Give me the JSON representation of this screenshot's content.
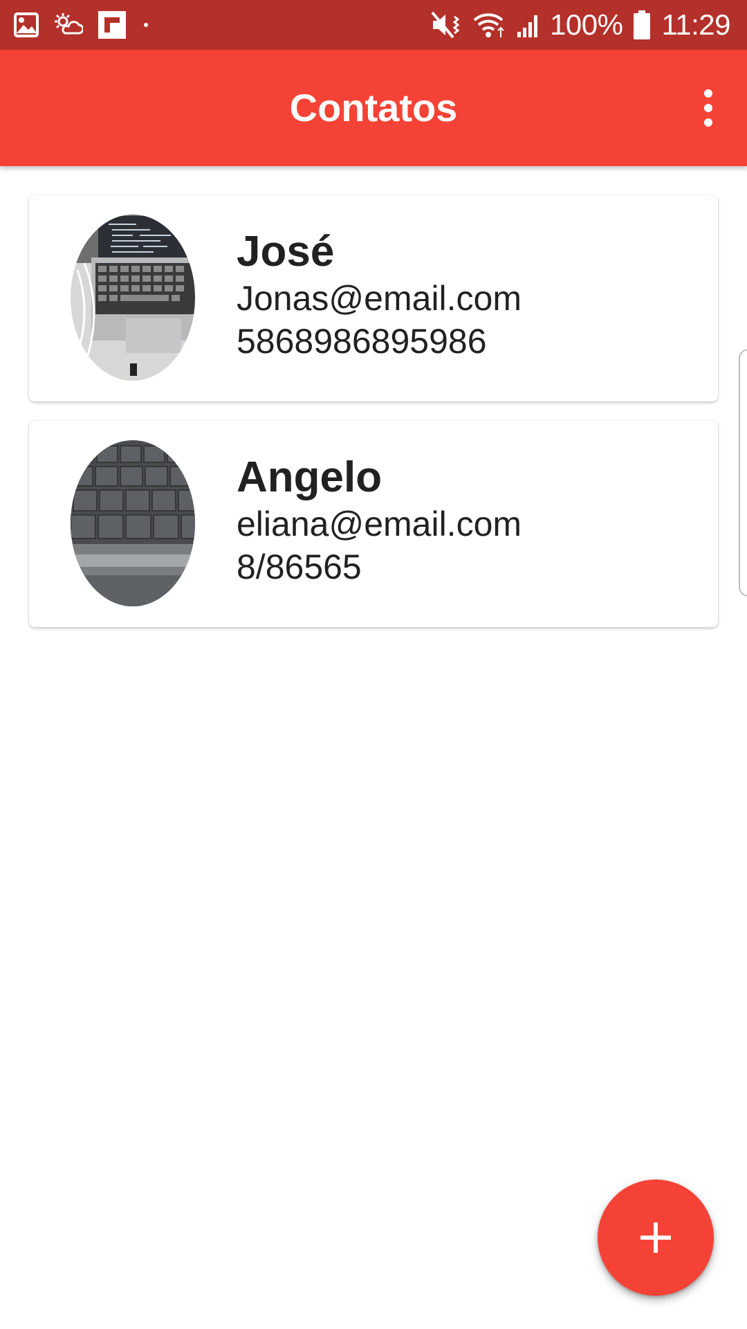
{
  "status_bar": {
    "notification_icons": [
      "gallery-icon",
      "weather-icon",
      "flipboard-icon",
      "more-notifications-dot-icon"
    ],
    "system_icons": [
      "mute-vibrate-icon",
      "wifi-icon",
      "signal-icon",
      "battery-icon"
    ],
    "battery": "100%",
    "time": "11:29"
  },
  "app_bar": {
    "title": "Contatos",
    "menu_icon": "more-vert-icon",
    "color": "#f44336",
    "status_color": "#b4302a"
  },
  "contacts": [
    {
      "name": "José",
      "email": "Jonas@email.com",
      "phone": "5868986895986",
      "avatar_icon": "laptop-photo-avatar"
    },
    {
      "name": "Angelo",
      "email": "eliana@email.com",
      "phone": "8/86565",
      "avatar_icon": "keyboard-photo-avatar"
    }
  ],
  "fab": {
    "icon": "plus-icon",
    "color": "#f44336"
  }
}
